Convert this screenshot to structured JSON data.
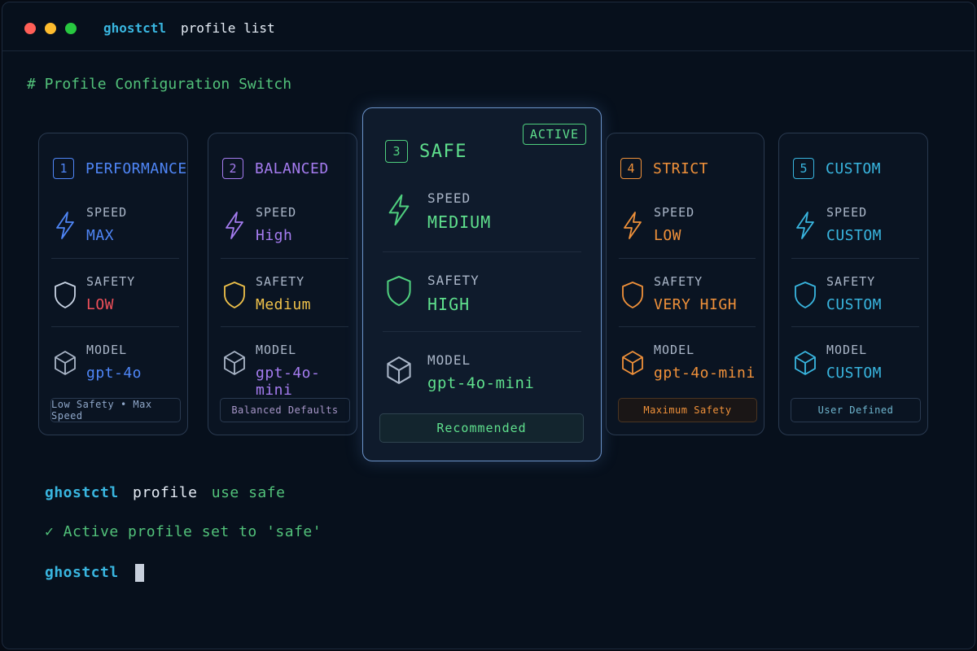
{
  "window": {
    "app": "ghostctl",
    "command": "profile list"
  },
  "comment": "# Profile Configuration Switch",
  "profiles": [
    {
      "num": "1",
      "name": "PERFORMANCE",
      "speed_label": "SPEED",
      "speed": "MAX",
      "safety_label": "SAFETY",
      "safety": "LOW",
      "model_label": "MODEL",
      "model": "gpt-4o",
      "tag": "Low Safety • Max Speed"
    },
    {
      "num": "2",
      "name": "BALANCED",
      "speed_label": "SPEED",
      "speed": "High",
      "safety_label": "SAFETY",
      "safety": "Medium",
      "model_label": "MODEL",
      "model": "gpt-4o-mini",
      "tag": "Balanced Defaults"
    },
    {
      "num": "3",
      "name": "SAFE",
      "active_label": "ACTIVE",
      "speed_label": "SPEED",
      "speed": "MEDIUM",
      "safety_label": "SAFETY",
      "safety": "HIGH",
      "model_label": "MODEL",
      "model": "gpt-4o-mini",
      "tag": "Recommended"
    },
    {
      "num": "4",
      "name": "STRICT",
      "speed_label": "SPEED",
      "speed": "LOW",
      "safety_label": "SAFETY",
      "safety": "VERY HIGH",
      "model_label": "MODEL",
      "model": "gpt-4o-mini",
      "tag": "Maximum Safety"
    },
    {
      "num": "5",
      "name": "CUSTOM",
      "speed_label": "SPEED",
      "speed": "CUSTOM",
      "safety_label": "SAFETY",
      "safety": "CUSTOM",
      "model_label": "MODEL",
      "model": "CUSTOM",
      "tag": "User Defined"
    }
  ],
  "terminal": {
    "cmd_app": "ghostctl",
    "cmd_word": "profile",
    "cmd_args": "use safe",
    "result": "✓ Active profile set to 'safe'",
    "prompt": "ghostctl"
  },
  "colors": {
    "performance": "#4f86f7",
    "balanced": "#a57cf0",
    "safe": "#4fcf7e",
    "strict": "#f0913a",
    "custom": "#39b6e0",
    "low_red": "#f0505a",
    "medium_yellow": "#f0c24a"
  },
  "icons": {
    "speed": "lightning-icon",
    "safety": "shield-icon",
    "model": "cube-icon"
  }
}
